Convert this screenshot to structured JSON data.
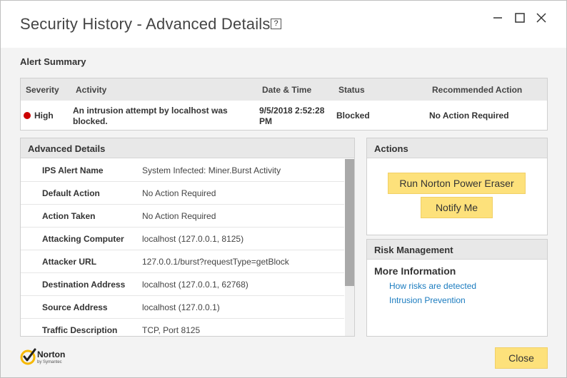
{
  "window": {
    "title": "Security History - Advanced Details",
    "help_label": "?"
  },
  "alert_summary": {
    "section_title": "Alert Summary",
    "headers": [
      "Severity",
      "Activity",
      "Date & Time",
      "Status",
      "Recommended Action"
    ],
    "row": {
      "severity": "High",
      "severity_color": "#cc0000",
      "activity_line1": "An intrusion attempt by localhost was",
      "activity_line2": "blocked.",
      "datetime_line1": "9/5/2018 2:52:28",
      "datetime_line2": "PM",
      "status": "Blocked",
      "recommended_action": "No Action Required"
    }
  },
  "advanced_details": {
    "title": "Advanced Details",
    "rows": [
      {
        "label": "IPS Alert Name",
        "value": "System Infected: Miner.Burst Activity"
      },
      {
        "label": "Default Action",
        "value": "No Action Required"
      },
      {
        "label": "Action Taken",
        "value": "No Action Required"
      },
      {
        "label": "Attacking Computer",
        "value": "localhost (127.0.0.1, 8125)"
      },
      {
        "label": "Attacker URL",
        "value": "127.0.0.1/burst?requestType=getBlock"
      },
      {
        "label": "Destination Address",
        "value": "localhost (127.0.0.1, 62768)"
      },
      {
        "label": "Source Address",
        "value": "localhost (127.0.0.1)"
      },
      {
        "label": "Traffic Description",
        "value": "TCP, Port 8125"
      }
    ]
  },
  "actions": {
    "title": "Actions",
    "run_eraser": "Run Norton Power Eraser",
    "notify_me": "Notify Me"
  },
  "risk_management": {
    "title": "Risk Management",
    "more_info": "More Information",
    "links": [
      "How risks are detected",
      "Intrusion Prevention"
    ]
  },
  "footer": {
    "logo_text": "Norton",
    "logo_sub": "by Symantec",
    "close_label": "Close"
  },
  "colors": {
    "accent_button": "#fde17b",
    "link": "#1a7bbf",
    "severity_high": "#cc0000"
  }
}
